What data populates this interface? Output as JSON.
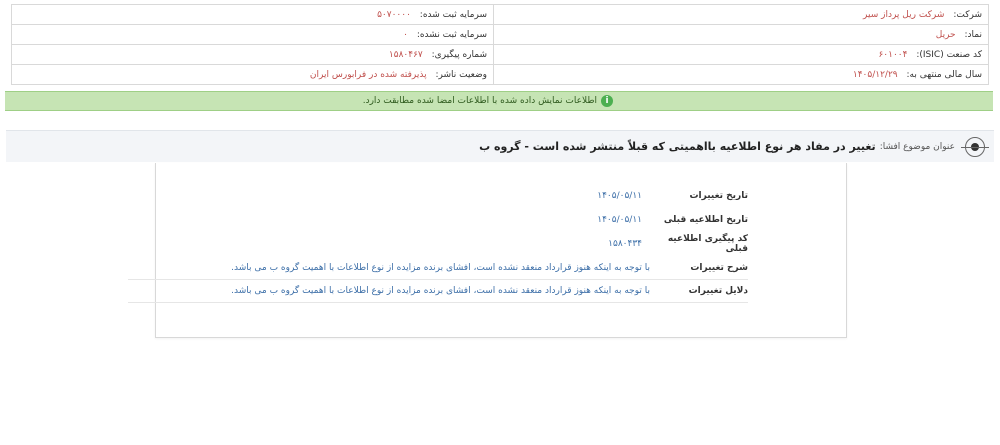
{
  "company_info": {
    "company_label": "شرکت:",
    "company_value": "شرکت ریل پرداز سیر",
    "registered_capital_label": "سرمایه ثبت شده:",
    "registered_capital_value": "۵۰۷۰۰۰۰",
    "symbol_label": "نماد:",
    "symbol_value": "حریل",
    "unregistered_capital_label": "سرمایه ثبت نشده:",
    "unregistered_capital_value": "۰",
    "isic_label": "کد صنعت (ISIC):",
    "isic_value": "۶۰۱۰۰۴",
    "tracking_label": "شماره پیگیری:",
    "tracking_value": "۱۵۸۰۴۶۷",
    "fiscal_year_label": "سال مالی منتهی به:",
    "fiscal_year_value": "۱۴۰۵/۱۲/۲۹",
    "publisher_status_label": "وضعیت ناشر:",
    "publisher_status_value": "پذیرفته شده در فرابورس ایران"
  },
  "banner": {
    "message": "اطلاعات نمایش داده شده با اطلاعات امضا شده مطابقت دارد.",
    "icon": "check-circle-icon",
    "color": "#c6e4b4"
  },
  "subject": {
    "label": "عنوان موضوع افشا:",
    "text": "تغییر در مفاد هر نوع اطلاعیه بااهمیتی که قبلاً منتشر شده است - گروه ب"
  },
  "details": [
    {
      "label": "تاریخ تغییرات",
      "value": "۱۴۰۵/۰۵/۱۱"
    },
    {
      "label": "تاریخ اطلاعیه قبلی",
      "value": "۱۴۰۵/۰۵/۱۱"
    },
    {
      "label": "کد پیگیری اطلاعیه قبلی",
      "value": "۱۵۸۰۴۳۴"
    },
    {
      "label": "شرح تغییرات",
      "value": "با توجه به اینکه هنوز قرارداد منعقد نشده است، افشای برنده مزایده از نوع اطلاعات با اهمیت گروه ب می باشد."
    },
    {
      "label": "دلایل تغییرات",
      "value": "با توجه به اینکه هنوز قرارداد منعقد نشده است، افشای برنده مزایده از نوع اطلاعات با اهمیت گروه ب می باشد."
    }
  ]
}
